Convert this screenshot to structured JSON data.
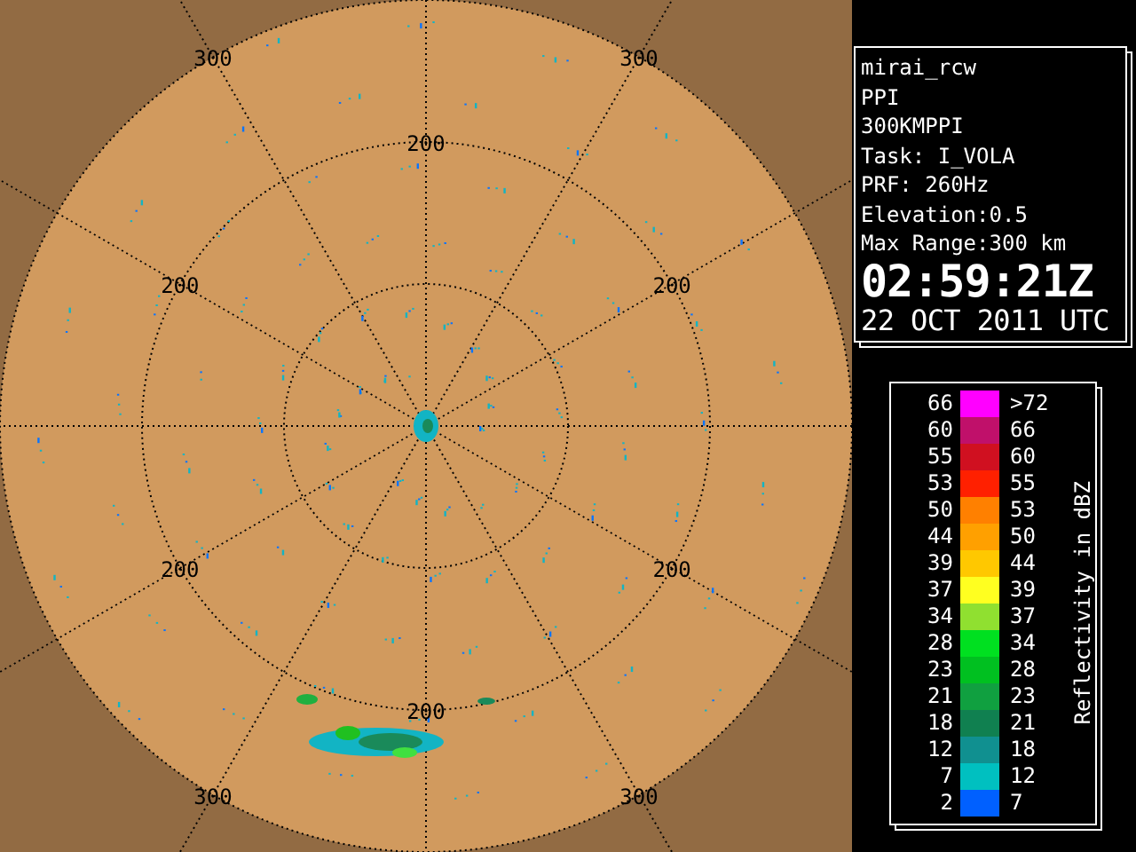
{
  "radar": {
    "range_labels": [
      {
        "text": "300"
      },
      {
        "text": "300"
      },
      {
        "text": "200"
      },
      {
        "text": "200"
      },
      {
        "text": "200"
      },
      {
        "text": "200"
      },
      {
        "text": "200"
      },
      {
        "text": "200"
      },
      {
        "text": "300"
      },
      {
        "text": "300"
      }
    ]
  },
  "info": {
    "lines": [
      "mirai_rcw",
      "PPI",
      "300KMPPI",
      "Task: I_VOLA",
      "PRF: 260Hz",
      "Elevation:0.5",
      "Max Range:300 km"
    ],
    "time": "02:59:21Z",
    "date": "22 OCT 2011 UTC"
  },
  "legend": {
    "title": "Reflectivity in dBZ",
    "rows": [
      {
        "low": "66",
        "high": ">72",
        "color": "#ff00ff"
      },
      {
        "low": "60",
        "high": "66",
        "color": "#c0106a"
      },
      {
        "low": "55",
        "high": "60",
        "color": "#d01020"
      },
      {
        "low": "53",
        "high": "55",
        "color": "#ff2000"
      },
      {
        "low": "50",
        "high": "53",
        "color": "#ff8000"
      },
      {
        "low": "44",
        "high": "50",
        "color": "#ffa000"
      },
      {
        "low": "39",
        "high": "44",
        "color": "#ffc800"
      },
      {
        "low": "37",
        "high": "39",
        "color": "#ffff20"
      },
      {
        "low": "34",
        "high": "37",
        "color": "#90e030"
      },
      {
        "low": "28",
        "high": "34",
        "color": "#00e020"
      },
      {
        "low": "23",
        "high": "28",
        "color": "#00c020"
      },
      {
        "low": "21",
        "high": "23",
        "color": "#10a040"
      },
      {
        "low": "18",
        "high": "21",
        "color": "#108050"
      },
      {
        "low": "12",
        "high": "18",
        "color": "#109090"
      },
      {
        "low": "7",
        "high": "12",
        "color": "#00c0c0"
      },
      {
        "low": "2",
        "high": "7",
        "color": "#0060ff"
      }
    ]
  }
}
